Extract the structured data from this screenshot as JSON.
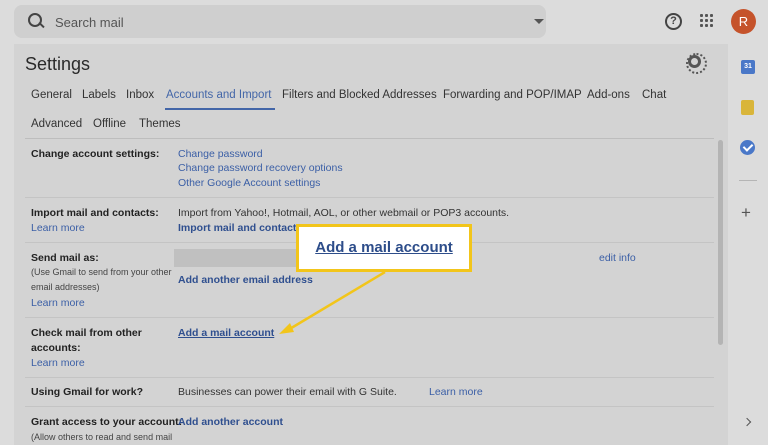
{
  "search": {
    "placeholder": "Search mail"
  },
  "header": {
    "help_icon_glyph": "?",
    "avatar_initial": "R"
  },
  "settings": {
    "title": "Settings",
    "tabs": [
      "General",
      "Labels",
      "Inbox",
      "Accounts and Import",
      "Filters and Blocked Addresses",
      "Forwarding and POP/IMAP",
      "Add-ons",
      "Chat",
      "Advanced",
      "Offline",
      "Themes"
    ],
    "active_tab": "Accounts and Import"
  },
  "rows": {
    "change_account": {
      "label": "Change account settings:",
      "links": [
        "Change password",
        "Change password recovery options",
        "Other Google Account settings"
      ]
    },
    "import_mail": {
      "label": "Import mail and contacts:",
      "learn_more": "Learn more",
      "text": "Import from Yahoo!, Hotmail, AOL, or other webmail or POP3 accounts.",
      "action": "Import mail and contacts"
    },
    "send_mail": {
      "label": "Send mail as:",
      "sub_line1": "(Use Gmail to send from your other",
      "sub_line2": "email addresses)",
      "learn_more": "Learn more",
      "edit": "edit info",
      "action": "Add another email address"
    },
    "check_mail": {
      "label_line1": "Check mail from other",
      "label_line2": "accounts:",
      "learn_more": "Learn more",
      "action": "Add a mail account"
    },
    "gmail_work": {
      "label": "Using Gmail for work?",
      "text": "Businesses can power their email with G Suite.",
      "learn_more": "Learn more"
    },
    "grant_access": {
      "label": "Grant access to your account:",
      "sub": "(Allow others to read and send mail",
      "action": "Add another account"
    }
  },
  "sidebar": {
    "calendar_glyph": "31"
  },
  "callout": {
    "text": "Add a mail account"
  },
  "colors": {
    "accent": "#4366a8",
    "callout_border": "#f2c51a",
    "avatar": "#c5532b"
  }
}
